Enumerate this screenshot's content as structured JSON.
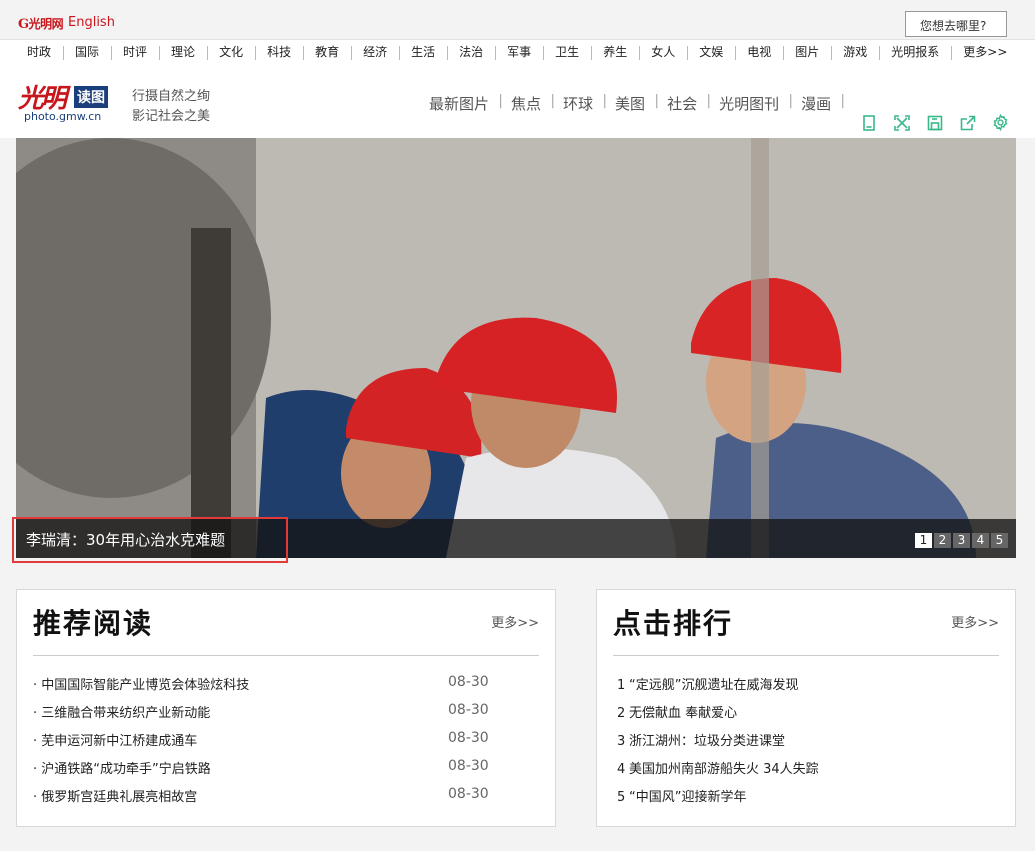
{
  "topbar": {
    "logo_text": "光明网",
    "english_label": "English",
    "search_placeholder": "您想去哪里?"
  },
  "nav": {
    "items": [
      "时政",
      "国际",
      "时评",
      "理论",
      "文化",
      "科技",
      "教育",
      "经济",
      "生活",
      "法治",
      "军事",
      "卫生",
      "养生",
      "女人",
      "文娱",
      "电视",
      "图片",
      "游戏",
      "光明报系",
      "更多>>"
    ]
  },
  "header": {
    "brand_cn": "光明",
    "brand_badge": "读图",
    "brand_url": "photo.gmw.cn",
    "slogan_line1": "行摄自然之绚",
    "slogan_line2": "影记社会之美",
    "channels": [
      "最新图片",
      "焦点",
      "环球",
      "美图",
      "社会",
      "光明图刊",
      "漫画"
    ]
  },
  "toolbar": {
    "icons": [
      "bookmark-icon",
      "fullscreen-icon",
      "save-icon",
      "share-icon",
      "settings-icon"
    ],
    "accent": "#3bb88a"
  },
  "slideshow": {
    "caption": "李瑞清：30年用心治水克难题",
    "pages": [
      "1",
      "2",
      "3",
      "4",
      "5"
    ],
    "active_page": "1"
  },
  "recommend": {
    "title": "推荐阅读",
    "more": "更多>>",
    "items": [
      {
        "title": "· 中国国际智能产业博览会体验炫科技",
        "date": "08-30"
      },
      {
        "title": "· 三维融合带来纺织产业新动能",
        "date": "08-30"
      },
      {
        "title": "· 芜申运河新中江桥建成通车",
        "date": "08-30"
      },
      {
        "title": "· 沪通铁路“成功牵手”宁启铁路",
        "date": "08-30"
      },
      {
        "title": "· 俄罗斯宫廷典礼展亮相故宫",
        "date": "08-30"
      }
    ]
  },
  "ranking": {
    "title": "点击排行",
    "more": "更多>>",
    "items": [
      {
        "rank": "1",
        "title": "“定远舰”沉舰遗址在威海发现"
      },
      {
        "rank": "2",
        "title": "无偿献血 奉献爱心"
      },
      {
        "rank": "3",
        "title": "浙江湖州：垃圾分类进课堂"
      },
      {
        "rank": "4",
        "title": "美国加州南部游船失火 34人失踪"
      },
      {
        "rank": "5",
        "title": "“中国风”迎接新学年"
      }
    ]
  }
}
